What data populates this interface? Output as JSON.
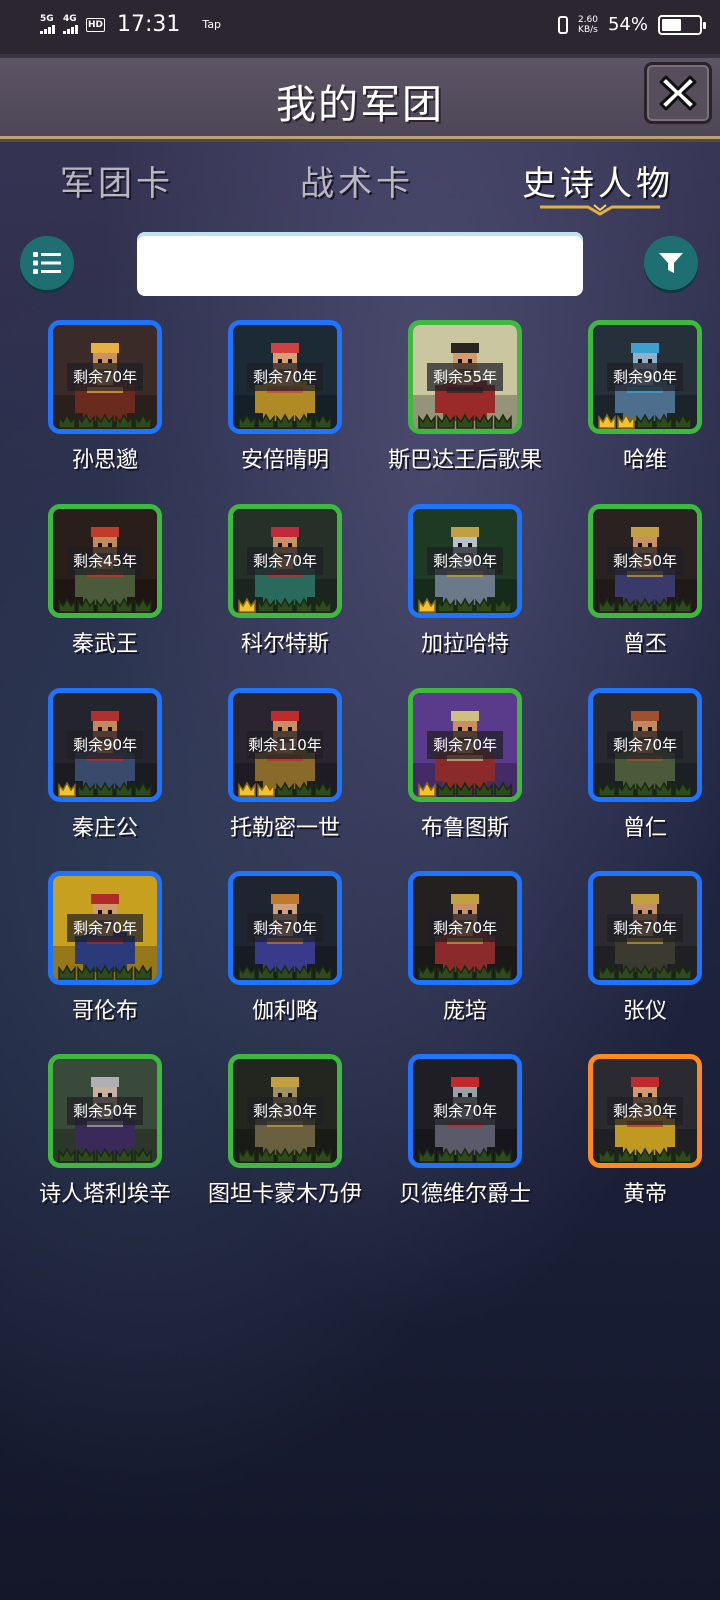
{
  "status_bar": {
    "net1": "5G",
    "net2": "4G",
    "hd": "HD",
    "time": "17:31",
    "app": "Tap",
    "speed_value": "2.60",
    "speed_unit": "KB/s",
    "battery": "54%",
    "battery_level": 0.54
  },
  "header": {
    "title": "我的军团",
    "close_icon": "close-x-icon"
  },
  "tabs": [
    {
      "label": "军团卡",
      "active": false
    },
    {
      "label": "战术卡",
      "active": false
    },
    {
      "label": "史诗人物",
      "active": true
    }
  ],
  "search": {
    "value": "",
    "placeholder": "",
    "list_icon": "list-icon",
    "filter_icon": "filter-icon"
  },
  "cards": [
    {
      "name": "孙思邈",
      "remain": "剩余70年",
      "frame": "blue",
      "crowns": 0,
      "bg": "#3a2a28",
      "skin": "#c9925e",
      "robe": "#6b2a1e",
      "accent": "#e8b040"
    },
    {
      "name": "安倍晴明",
      "remain": "剩余70年",
      "frame": "blue",
      "crowns": 0,
      "bg": "#1c2a36",
      "skin": "#d6a070",
      "robe": "#b08a24",
      "accent": "#d04040"
    },
    {
      "name": "斯巴达王后歌果",
      "remain": "剩余55年",
      "frame": "green",
      "crowns": 0,
      "bg": "#c9c6a0",
      "skin": "#d49b6a",
      "robe": "#9a2a2a",
      "accent": "#2a2420"
    },
    {
      "name": "哈维",
      "remain": "剩余90年",
      "frame": "green",
      "crowns": 2,
      "bg": "#26303a",
      "skin": "#8fb0c8",
      "robe": "#4e6e8e",
      "accent": "#3aa0d0"
    },
    {
      "name": "秦武王",
      "remain": "剩余45年",
      "frame": "green",
      "crowns": 0,
      "bg": "#2a1e1a",
      "skin": "#c08a5a",
      "robe": "#4a5a3a",
      "accent": "#c23a2a"
    },
    {
      "name": "科尔特斯",
      "remain": "剩余70年",
      "frame": "green",
      "crowns": 1,
      "bg": "#243028",
      "skin": "#c89060",
      "robe": "#2a6a5a",
      "accent": "#c02a3a"
    },
    {
      "name": "加拉哈特",
      "remain": "剩余90年",
      "frame": "blue",
      "crowns": 1,
      "bg": "#1e3a24",
      "skin": "#b8c0c8",
      "robe": "#6a7a8a",
      "accent": "#c0a040"
    },
    {
      "name": "曾丕",
      "remain": "剩余50年",
      "frame": "green",
      "crowns": 0,
      "bg": "#2a2220",
      "skin": "#c89060",
      "robe": "#3a3a6a",
      "accent": "#c0a040"
    },
    {
      "name": "秦庄公",
      "remain": "剩余90年",
      "frame": "blue",
      "crowns": 1,
      "bg": "#24242e",
      "skin": "#c08a5a",
      "robe": "#3a4a6a",
      "accent": "#b03030"
    },
    {
      "name": "托勒密一世",
      "remain": "剩余110年",
      "frame": "blue",
      "crowns": 2,
      "bg": "#2a2430",
      "skin": "#c89060",
      "robe": "#8a6a2a",
      "accent": "#c02a2a"
    },
    {
      "name": "布鲁图斯",
      "remain": "剩余70年",
      "frame": "green",
      "crowns": 1,
      "bg": "#5a3a8a",
      "skin": "#c89060",
      "robe": "#8a2a2a",
      "accent": "#d0c080"
    },
    {
      "name": "曾仁",
      "remain": "剩余70年",
      "frame": "blue",
      "crowns": 0,
      "bg": "#262a30",
      "skin": "#c08a5a",
      "robe": "#4a5a3a",
      "accent": "#a05030"
    },
    {
      "name": "哥伦布",
      "remain": "剩余70年",
      "frame": "blue",
      "crowns": 0,
      "bg": "#c8a020",
      "skin": "#d09a6a",
      "robe": "#2a3a7a",
      "accent": "#b02a2a"
    },
    {
      "name": "伽利略",
      "remain": "剩余70年",
      "frame": "blue",
      "crowns": 0,
      "bg": "#1e2430",
      "skin": "#d0a07a",
      "robe": "#3a3a8a",
      "accent": "#c07a30"
    },
    {
      "name": "庞培",
      "remain": "剩余70年",
      "frame": "blue",
      "crowns": 0,
      "bg": "#242020",
      "skin": "#c89060",
      "robe": "#8a2a2a",
      "accent": "#c0a040"
    },
    {
      "name": "张仪",
      "remain": "剩余70年",
      "frame": "blue",
      "crowns": 0,
      "bg": "#2a2a30",
      "skin": "#c89060",
      "robe": "#3a3a30",
      "accent": "#c0a040"
    },
    {
      "name": "诗人塔利埃辛",
      "remain": "剩余50年",
      "frame": "green",
      "crowns": 0,
      "bg": "#3a4a3a",
      "skin": "#c8b0a0",
      "robe": "#3a2a5a",
      "accent": "#b0b0b0"
    },
    {
      "name": "图坦卡蒙木乃伊",
      "remain": "剩余30年",
      "frame": "green",
      "crowns": 0,
      "bg": "#22261e",
      "skin": "#a09060",
      "robe": "#6a6040",
      "accent": "#c0a040"
    },
    {
      "name": "贝德维尔爵士",
      "remain": "剩余70年",
      "frame": "blue",
      "crowns": 0,
      "bg": "#1e1e24",
      "skin": "#9aa0a8",
      "robe": "#5a5a6a",
      "accent": "#c02a2a"
    },
    {
      "name": "黄帝",
      "remain": "剩余30年",
      "frame": "orange",
      "crowns": 0,
      "bg": "#2a2a30",
      "skin": "#d09a6a",
      "robe": "#c09a20",
      "accent": "#c02a2a"
    }
  ]
}
